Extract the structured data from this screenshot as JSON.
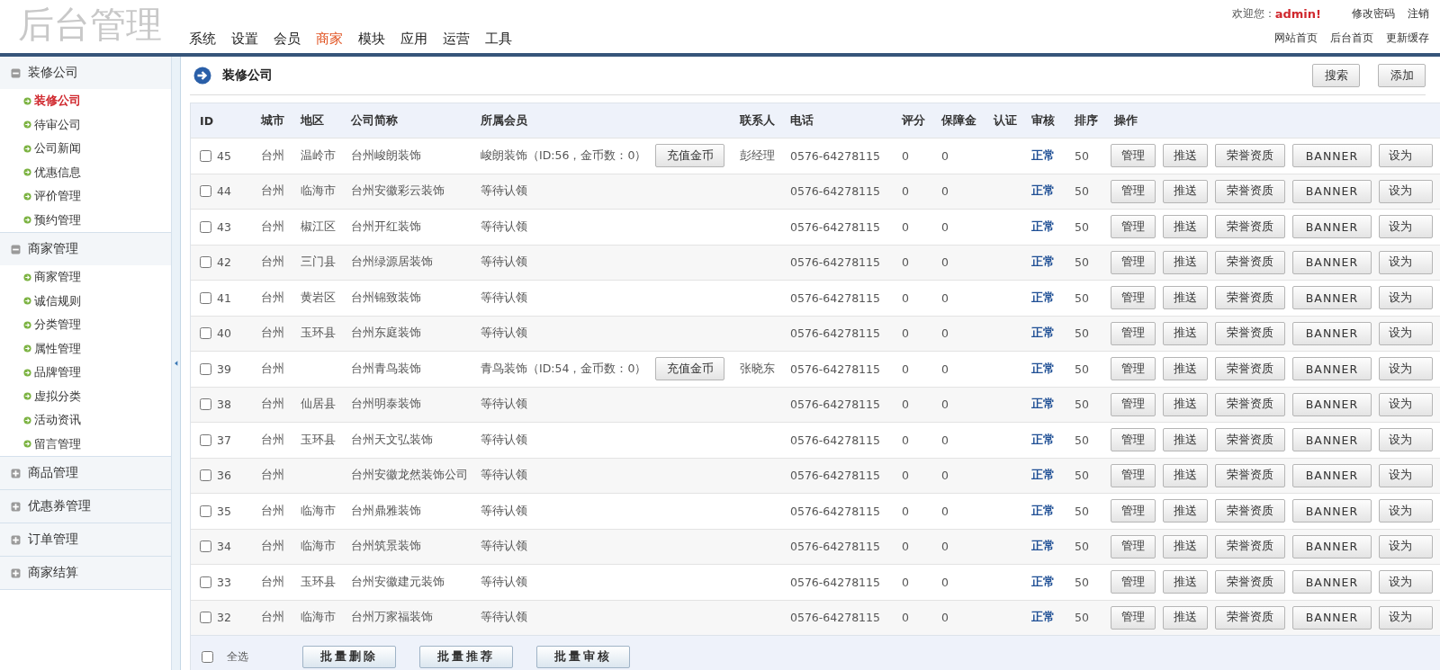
{
  "header": {
    "logo": "后台管理",
    "nav": [
      {
        "label": "系统",
        "selected": false
      },
      {
        "label": "设置",
        "selected": false
      },
      {
        "label": "会员",
        "selected": false
      },
      {
        "label": "商家",
        "selected": true
      },
      {
        "label": "模块",
        "selected": false
      },
      {
        "label": "应用",
        "selected": false
      },
      {
        "label": "运营",
        "selected": false
      },
      {
        "label": "工具",
        "selected": false
      }
    ],
    "welcome": "欢迎您：",
    "user": "admin!",
    "user_links": [
      "修改密码",
      "注销"
    ],
    "site_links": [
      "网站首页",
      "后台首页",
      "更新缓存"
    ]
  },
  "sidebar": [
    {
      "title": "装修公司",
      "expanded": true,
      "items": [
        {
          "label": "装修公司",
          "selected": true
        },
        {
          "label": "待审公司",
          "selected": false
        },
        {
          "label": "公司新闻",
          "selected": false
        },
        {
          "label": "优惠信息",
          "selected": false
        },
        {
          "label": "评价管理",
          "selected": false
        },
        {
          "label": "预约管理",
          "selected": false
        }
      ]
    },
    {
      "title": "商家管理",
      "expanded": true,
      "items": [
        {
          "label": "商家管理",
          "selected": false
        },
        {
          "label": "诚信规则",
          "selected": false
        },
        {
          "label": "分类管理",
          "selected": false
        },
        {
          "label": "属性管理",
          "selected": false
        },
        {
          "label": "品牌管理",
          "selected": false
        },
        {
          "label": "虚拟分类",
          "selected": false
        },
        {
          "label": "活动资讯",
          "selected": false
        },
        {
          "label": "留言管理",
          "selected": false
        }
      ]
    },
    {
      "title": "商品管理",
      "expanded": false
    },
    {
      "title": "优惠券管理",
      "expanded": false
    },
    {
      "title": "订单管理",
      "expanded": false
    },
    {
      "title": "商家结算",
      "expanded": false
    }
  ],
  "page": {
    "title": "装修公司",
    "buttons": [
      "搜索",
      "添加"
    ]
  },
  "table": {
    "columns": [
      "ID",
      "城市",
      "地区",
      "公司简称",
      "所属会员",
      "联系人",
      "电话",
      "评分",
      "保障金",
      "认证",
      "审核",
      "排序",
      "操作"
    ],
    "rows": [
      {
        "checked": false,
        "id": "45",
        "city": "台州",
        "district": "温岭市",
        "company": "台州峻朗装饰",
        "member": "峻朗装饰（ID:56，金币数：0）",
        "recharge": "充值金币",
        "contact": "彭经理",
        "phone": "0576-64278115",
        "score": "0",
        "deposit": "0",
        "status": "正常",
        "sort": "50",
        "actions": [
          "管理",
          "推送",
          "荣誉资质",
          "BANNER",
          "设为"
        ]
      },
      {
        "checked": false,
        "id": "44",
        "city": "台州",
        "district": "临海市",
        "company": "台州安徽彩云装饰",
        "member": "等待认领",
        "phone": "0576-64278115",
        "score": "0",
        "deposit": "0",
        "status": "正常",
        "sort": "50",
        "actions": [
          "管理",
          "推送",
          "荣誉资质",
          "BANNER",
          "设为"
        ]
      },
      {
        "checked": false,
        "id": "43",
        "city": "台州",
        "district": "椒江区",
        "company": "台州开红装饰",
        "member": "等待认领",
        "phone": "0576-64278115",
        "score": "0",
        "deposit": "0",
        "status": "正常",
        "sort": "50",
        "actions": [
          "管理",
          "推送",
          "荣誉资质",
          "BANNER",
          "设为"
        ]
      },
      {
        "checked": false,
        "id": "42",
        "city": "台州",
        "district": "三门县",
        "company": "台州绿源居装饰",
        "member": "等待认领",
        "phone": "0576-64278115",
        "score": "0",
        "deposit": "0",
        "status": "正常",
        "sort": "50",
        "actions": [
          "管理",
          "推送",
          "荣誉资质",
          "BANNER",
          "设为"
        ]
      },
      {
        "checked": false,
        "id": "41",
        "city": "台州",
        "district": "黄岩区",
        "company": "台州锦致装饰",
        "member": "等待认领",
        "phone": "0576-64278115",
        "score": "0",
        "deposit": "0",
        "status": "正常",
        "sort": "50",
        "actions": [
          "管理",
          "推送",
          "荣誉资质",
          "BANNER",
          "设为"
        ]
      },
      {
        "checked": false,
        "id": "40",
        "city": "台州",
        "district": "玉环县",
        "company": "台州东庭装饰",
        "member": "等待认领",
        "phone": "0576-64278115",
        "score": "0",
        "deposit": "0",
        "status": "正常",
        "sort": "50",
        "actions": [
          "管理",
          "推送",
          "荣誉资质",
          "BANNER",
          "设为"
        ]
      },
      {
        "checked": false,
        "id": "39",
        "city": "台州",
        "company": "台州青鸟装饰",
        "member": "青鸟装饰（ID:54，金币数：0）",
        "recharge": "充值金币",
        "contact": "张晓东",
        "phone": "0576-64278115",
        "score": "0",
        "deposit": "0",
        "status": "正常",
        "sort": "50",
        "actions": [
          "管理",
          "推送",
          "荣誉资质",
          "BANNER",
          "设为"
        ]
      },
      {
        "checked": false,
        "id": "38",
        "city": "台州",
        "district": "仙居县",
        "company": "台州明泰装饰",
        "member": "等待认领",
        "phone": "0576-64278115",
        "score": "0",
        "deposit": "0",
        "status": "正常",
        "sort": "50",
        "actions": [
          "管理",
          "推送",
          "荣誉资质",
          "BANNER",
          "设为"
        ]
      },
      {
        "checked": false,
        "id": "37",
        "city": "台州",
        "district": "玉环县",
        "company": "台州天文弘装饰",
        "member": "等待认领",
        "phone": "0576-64278115",
        "score": "0",
        "deposit": "0",
        "status": "正常",
        "sort": "50",
        "actions": [
          "管理",
          "推送",
          "荣誉资质",
          "BANNER",
          "设为"
        ]
      },
      {
        "checked": false,
        "id": "36",
        "city": "台州",
        "company": "台州安徽龙然装饰公司",
        "member": "等待认领",
        "phone": "0576-64278115",
        "score": "0",
        "deposit": "0",
        "status": "正常",
        "sort": "50",
        "actions": [
          "管理",
          "推送",
          "荣誉资质",
          "BANNER",
          "设为"
        ]
      },
      {
        "checked": false,
        "id": "35",
        "city": "台州",
        "district": "临海市",
        "company": "台州鼎雅装饰",
        "member": "等待认领",
        "phone": "0576-64278115",
        "score": "0",
        "deposit": "0",
        "status": "正常",
        "sort": "50",
        "actions": [
          "管理",
          "推送",
          "荣誉资质",
          "BANNER",
          "设为"
        ]
      },
      {
        "checked": false,
        "id": "34",
        "city": "台州",
        "district": "临海市",
        "company": "台州筑景装饰",
        "member": "等待认领",
        "phone": "0576-64278115",
        "score": "0",
        "deposit": "0",
        "status": "正常",
        "sort": "50",
        "actions": [
          "管理",
          "推送",
          "荣誉资质",
          "BANNER",
          "设为"
        ]
      },
      {
        "checked": false,
        "id": "33",
        "city": "台州",
        "district": "玉环县",
        "company": "台州安徽建元装饰",
        "member": "等待认领",
        "phone": "0576-64278115",
        "score": "0",
        "deposit": "0",
        "status": "正常",
        "sort": "50",
        "actions": [
          "管理",
          "推送",
          "荣誉资质",
          "BANNER",
          "设为"
        ]
      },
      {
        "checked": false,
        "id": "32",
        "city": "台州",
        "district": "临海市",
        "company": "台州万家福装饰",
        "member": "等待认领",
        "phone": "0576-64278115",
        "score": "0",
        "deposit": "0",
        "status": "正常",
        "sort": "50",
        "actions": [
          "管理",
          "推送",
          "荣誉资质",
          "BANNER",
          "设为"
        ]
      }
    ]
  },
  "footer": {
    "select_all": {
      "label": "全选",
      "checked": false
    },
    "buttons": [
      "批量删除",
      "批量推荐",
      "批量审核"
    ]
  }
}
